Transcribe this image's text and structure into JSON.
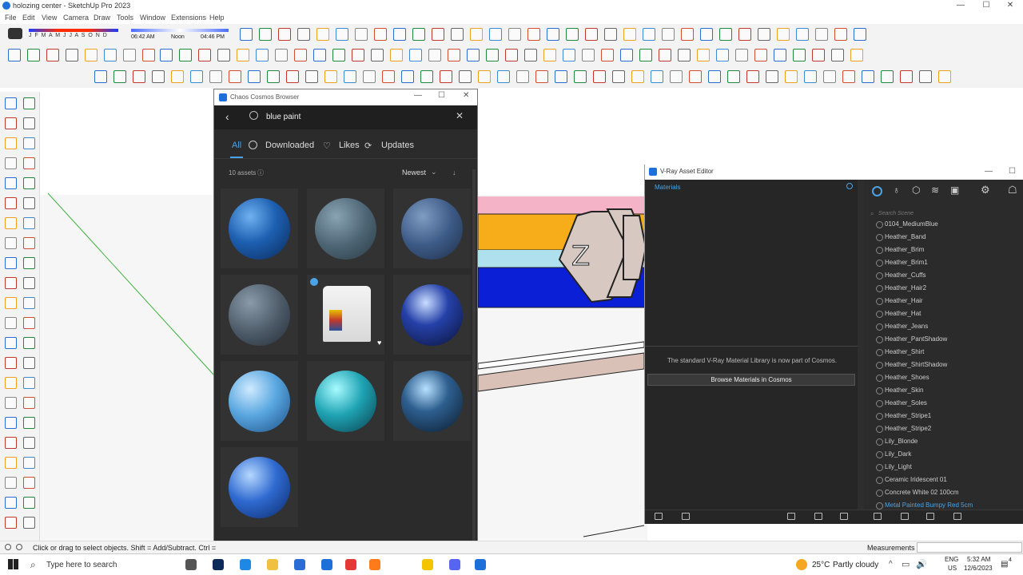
{
  "window": {
    "title": "holozing center - SketchUp Pro 2023",
    "min": "—",
    "max": "☐",
    "close": "✕"
  },
  "menu": [
    "File",
    "Edit",
    "View",
    "Camera",
    "Draw",
    "Tools",
    "Window",
    "Extensions",
    "Help"
  ],
  "shadows": {
    "months": "J F M A M J J A S O N D",
    "time_start": "06:42 AM",
    "time_mid": "Noon",
    "time_end": "04:46 PM"
  },
  "status": {
    "message": "Click or drag to select objects. Shift = Add/Subtract. Ctrl ="
  },
  "measurements": {
    "label": "Measurements",
    "value": ""
  },
  "cosmos": {
    "title": "Chaos Cosmos Browser",
    "search_value": "blue paint",
    "tabs": {
      "all": "All",
      "downloaded": "Downloaded",
      "likes": "Likes",
      "updates": "Updates"
    },
    "asset_count": "10 assets",
    "sort": "Newest"
  },
  "vray": {
    "title": "V-Ray Asset Editor",
    "section": "Materials",
    "search_placeholder": "Search Scene",
    "notice": "The standard V-Ray Material Library is now part of Cosmos.",
    "browse_button": "Browse Materials in Cosmos",
    "materials": [
      "0104_MediumBlue",
      "Heather_Band",
      "Heather_Brim",
      "Heather_Brim1",
      "Heather_Cuffs",
      "Heather_Hair2",
      "Heather_Hair",
      "Heather_Hat",
      "Heather_Jeans",
      "Heather_PantShadow",
      "Heather_Shirt",
      "Heather_ShirtShadow",
      "Heather_Shoes",
      "Heather_Skin",
      "Heather_Soles",
      "Heather_Stripe1",
      "Heather_Stripe2",
      "Lily_Blonde",
      "Lily_Dark",
      "Lily_Light",
      "Ceramic Iridescent 01",
      "Concrete White 02 100cm",
      "Metal Painted Bumpy Red 5cm"
    ]
  },
  "taskbar": {
    "search_placeholder": "Type here to search",
    "weather_temp": "25°C",
    "weather_text": "Partly cloudy",
    "lang_top": "ENG",
    "lang_bottom": "US",
    "time": "5:32 AM",
    "date": "12/6/2023",
    "notif_count": "4"
  },
  "colors": {
    "accent": "#4aa3e6",
    "stripe_pink": "#f5b3c8",
    "stripe_orange": "#f7ad1a",
    "stripe_lightblue": "#aee0ee",
    "stripe_blue": "#0b1fd6",
    "stripe_tan": "#d9c1b8"
  }
}
